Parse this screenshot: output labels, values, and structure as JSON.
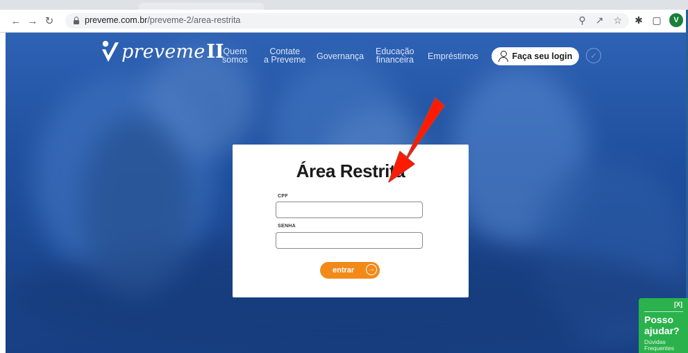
{
  "browser": {
    "url_host": "preveme.com.br",
    "url_path": "/preveme-2/area-restrita",
    "profile_initial": "V"
  },
  "site": {
    "logo_text": "preveme",
    "logo_roman": "II",
    "nav": [
      {
        "line1": "Quem",
        "line2": "somos"
      },
      {
        "line1": "Contate",
        "line2": "a Preveme"
      },
      {
        "line1": "Governança",
        "line2": ""
      },
      {
        "line1": "Educação",
        "line2": "financeira"
      },
      {
        "line1": "Empréstimos",
        "line2": ""
      }
    ],
    "login_button": "Faça seu login"
  },
  "login_card": {
    "title": "Área Restrita",
    "cpf_label": "CPF",
    "password_label": "SENHA",
    "cpf_value": "",
    "password_value": "",
    "submit_label": "entrar"
  },
  "help_widget": {
    "close": "[X]",
    "title_line1": "Posso",
    "title_line2": "ajudar?",
    "sub_line1": "Dúvidas",
    "sub_line2": "Frequentes"
  },
  "colors": {
    "hero_blue": "#1f4f9e",
    "submit_orange": "#f28a1a",
    "widget_green": "#2bb24c",
    "annotation_red": "#ff1a00"
  }
}
